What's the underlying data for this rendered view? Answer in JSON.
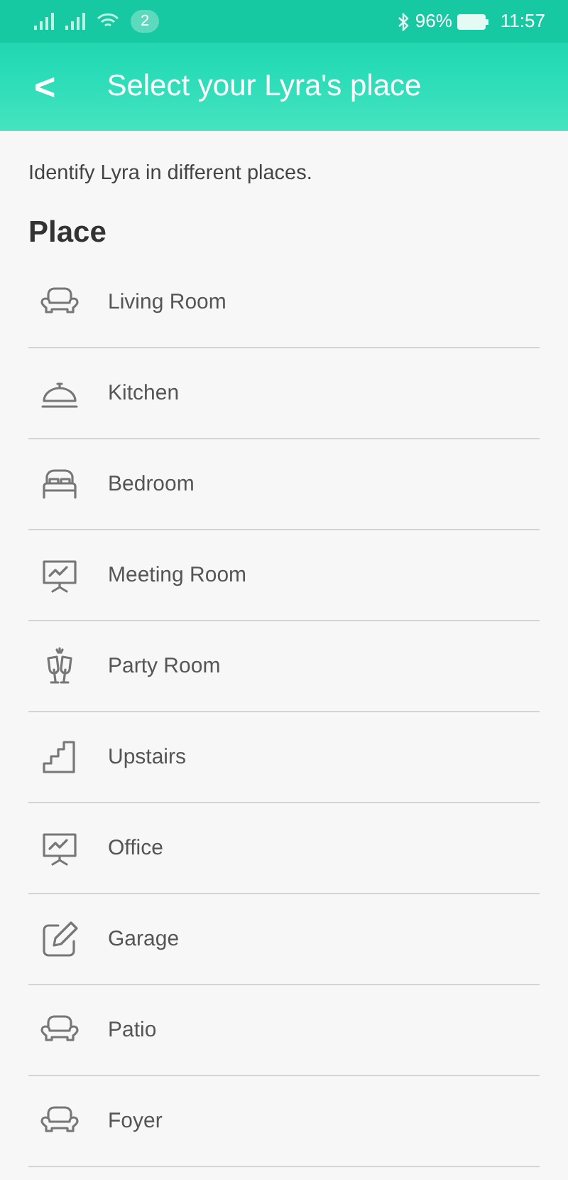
{
  "status_bar": {
    "notification_count": "2",
    "battery": "96%",
    "time": "11:57"
  },
  "header": {
    "back": "<",
    "title": "Select your Lyra's place"
  },
  "intro": "Identify Lyra in different places.",
  "section_title": "Place",
  "places": [
    {
      "label": "Living Room",
      "kind": "sofa"
    },
    {
      "label": "Kitchen",
      "kind": "cloche"
    },
    {
      "label": "Bedroom",
      "kind": "bed"
    },
    {
      "label": "Meeting Room",
      "kind": "board"
    },
    {
      "label": "Party Room",
      "kind": "glasses"
    },
    {
      "label": "Upstairs",
      "kind": "stairs"
    },
    {
      "label": "Office",
      "kind": "board"
    },
    {
      "label": "Garage",
      "kind": "edit"
    },
    {
      "label": "Patio",
      "kind": "sofa"
    },
    {
      "label": "Foyer",
      "kind": "sofa"
    }
  ]
}
